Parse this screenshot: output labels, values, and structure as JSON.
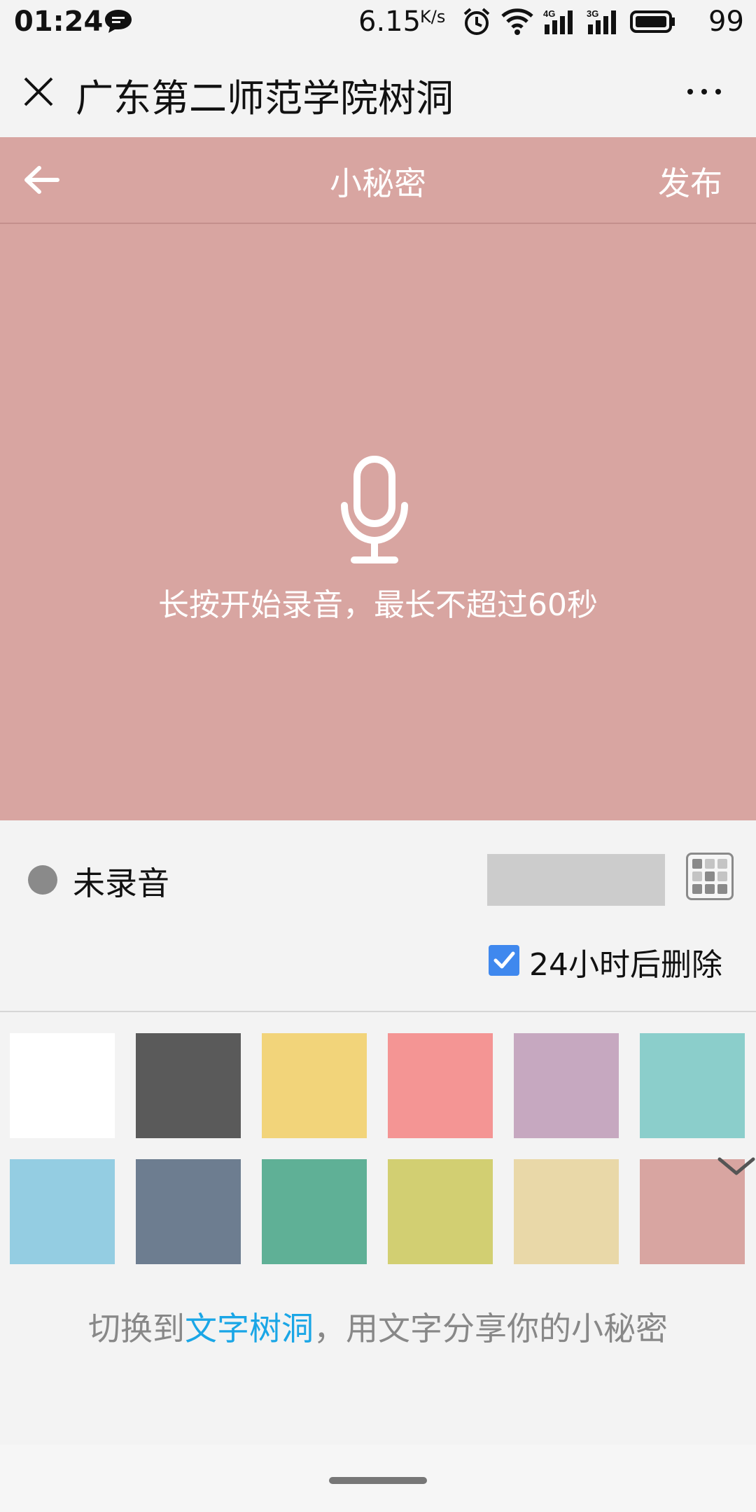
{
  "status_bar": {
    "time": "01:24",
    "speed": "6.15",
    "speed_unit": "K/s",
    "battery": "99",
    "icons": [
      "message-icon",
      "alarm-icon",
      "wifi-icon",
      "signal-4g-icon",
      "signal-3g-icon",
      "battery-icon"
    ],
    "signal_4g": "4G",
    "signal_3g": "3G"
  },
  "wx_bar": {
    "title": "广东第二师范学院树洞",
    "icons": [
      "close-icon",
      "more-icon"
    ]
  },
  "header": {
    "title": "小秘密",
    "publish_label": "发布",
    "icons": [
      "back-arrow-icon"
    ],
    "color": "#d8a5a1"
  },
  "record": {
    "hint": "长按开始录音，最长不超过60秒",
    "icon": "microphone-icon"
  },
  "controls": {
    "status": "未录音",
    "checkbox_label": "24小时后删除",
    "checkbox_checked": true,
    "icons": [
      "status-dot-icon",
      "grid-icon"
    ]
  },
  "swatches": {
    "colors": [
      "#ffffff",
      "#5a5a5a",
      "#f2d47a",
      "#f49594",
      "#c6a8c0",
      "#8bcecb",
      "#94cde2",
      "#6d7d90",
      "#5fb096",
      "#d2cf72",
      "#e9d8a8",
      "#d8a5a1"
    ],
    "selected": 11,
    "icons": [
      "chevron-down-icon"
    ]
  },
  "switch_text": {
    "prefix": "切换到",
    "link": "文字树洞",
    "suffix": "，用文字分享你的小秘密"
  }
}
